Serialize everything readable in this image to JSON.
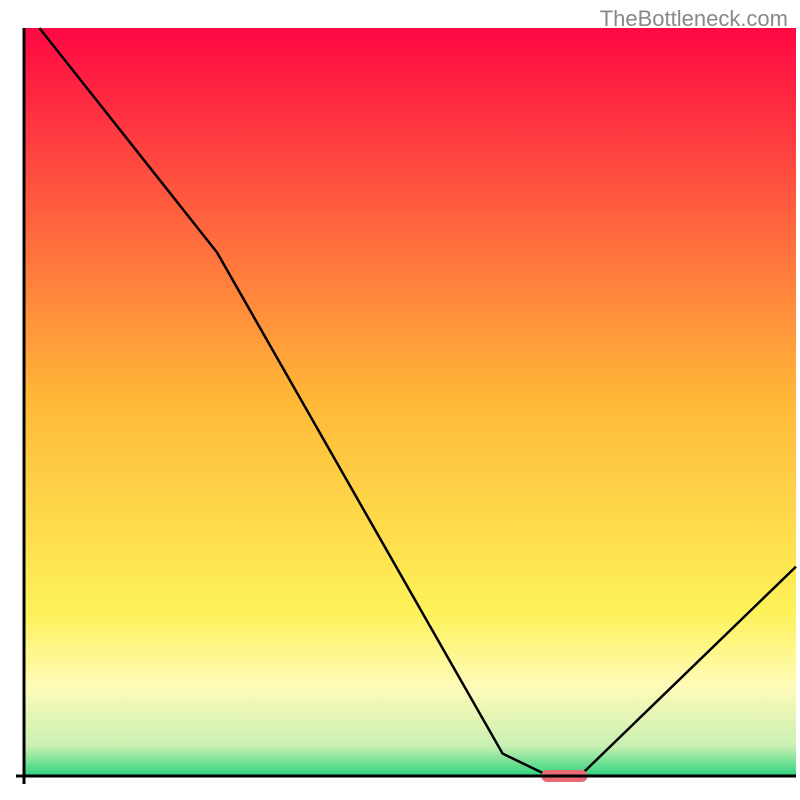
{
  "watermark": "TheBottleneck.com",
  "chart_data": {
    "type": "line",
    "title": "",
    "xlabel": "",
    "ylabel": "",
    "xlim": [
      0,
      100
    ],
    "ylim": [
      0,
      100
    ],
    "x": [
      2,
      25,
      62,
      68,
      72,
      100
    ],
    "values": [
      100,
      70,
      3,
      0,
      0,
      28
    ],
    "marker": {
      "x_range": [
        67,
        73
      ],
      "y": 0,
      "color": "#e96a75"
    },
    "background_gradient": [
      {
        "stop": 0.0,
        "color": "#ff0844"
      },
      {
        "stop": 0.5,
        "color": "#ffb938"
      },
      {
        "stop": 0.78,
        "color": "#fdf259"
      },
      {
        "stop": 0.88,
        "color": "#fffbb8"
      },
      {
        "stop": 0.96,
        "color": "#c9f0b3"
      },
      {
        "stop": 1.0,
        "color": "#2bd37d"
      }
    ],
    "axis_color": "#000000",
    "line_color": "#000000"
  }
}
